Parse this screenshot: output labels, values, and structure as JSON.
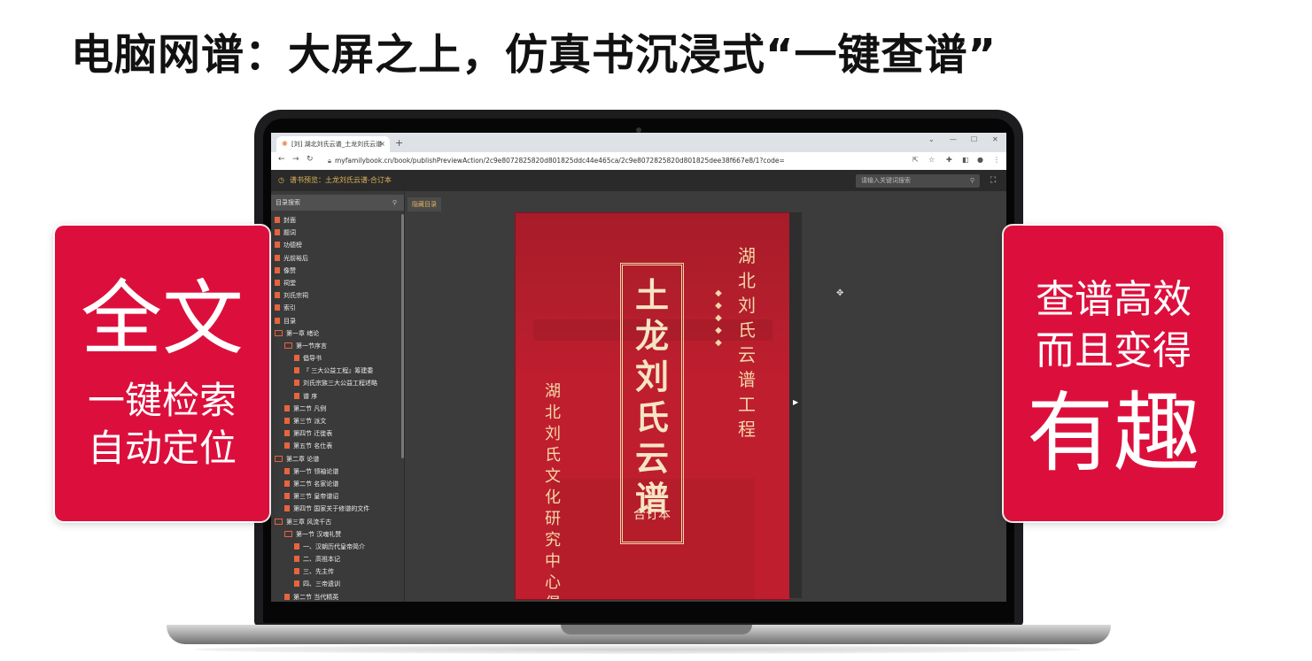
{
  "headline": "电脑网谱：大屏之上，仿真书沉浸式“一键查谱”",
  "browser": {
    "tab_title": "[刘] 湖北刘氏云谱_土龙刘氏云谱",
    "tab_close": "×",
    "new_tab": "+",
    "url": "myfamilybook.cn/book/publishPreviewAction/2c9e8072825820d801825ddc44e465ca/2c9e8072825820d801825dee38f667e8/1?code="
  },
  "app": {
    "title": "谱书预览：土龙刘氏云谱-合订本",
    "search_placeholder": "请输入关键词搜索",
    "sidebar_search_placeholder": "目录搜索",
    "hide_toc_label": "隐藏目录"
  },
  "toc": [
    {
      "label": "封面",
      "level": 0,
      "type": "page"
    },
    {
      "label": "题词",
      "level": 0,
      "type": "page"
    },
    {
      "label": "功德榜",
      "level": 0,
      "type": "page"
    },
    {
      "label": "光前裕后",
      "level": 0,
      "type": "page"
    },
    {
      "label": "像赞",
      "level": 0,
      "type": "page"
    },
    {
      "label": "祠堂",
      "level": 0,
      "type": "page"
    },
    {
      "label": "刘氏宗祠",
      "level": 0,
      "type": "page"
    },
    {
      "label": "索引",
      "level": 0,
      "type": "page"
    },
    {
      "label": "目录",
      "level": 0,
      "type": "page"
    },
    {
      "label": "第一章 绪论",
      "level": 0,
      "type": "folder"
    },
    {
      "label": "第一节序言",
      "level": 1,
      "type": "folder"
    },
    {
      "label": "倡导书",
      "level": 2,
      "type": "page"
    },
    {
      "label": "『 三大公益工程』筹建委",
      "level": 2,
      "type": "page"
    },
    {
      "label": "刘氏宗族三大公益工程述略",
      "level": 2,
      "type": "page"
    },
    {
      "label": "谱 序",
      "level": 2,
      "type": "page"
    },
    {
      "label": "第二节 凡例",
      "level": 1,
      "type": "page"
    },
    {
      "label": "第三节 派文",
      "level": 1,
      "type": "page"
    },
    {
      "label": "第四节 迁徙表",
      "level": 1,
      "type": "page"
    },
    {
      "label": "第五节 名仕表",
      "level": 1,
      "type": "page"
    },
    {
      "label": "第二章 论谱",
      "level": 0,
      "type": "folder"
    },
    {
      "label": "第一节 领袖论谱",
      "level": 1,
      "type": "page"
    },
    {
      "label": "第二节 名家论谱",
      "level": 1,
      "type": "page"
    },
    {
      "label": "第三节 皇帝谱诏",
      "level": 1,
      "type": "page"
    },
    {
      "label": "第四节 国家关于修谱的文件",
      "level": 1,
      "type": "page"
    },
    {
      "label": "第三章 风流千古",
      "level": 0,
      "type": "folder"
    },
    {
      "label": "第一节 汉魂礼赞",
      "level": 1,
      "type": "folder"
    },
    {
      "label": "一、汉朝历代皇帝简介",
      "level": 2,
      "type": "page"
    },
    {
      "label": "二、高祖本记",
      "level": 2,
      "type": "page"
    },
    {
      "label": "三、先主传",
      "level": 2,
      "type": "page"
    },
    {
      "label": "四、三帝遗训",
      "level": 2,
      "type": "page"
    },
    {
      "label": "第二节 当代精英",
      "level": 1,
      "type": "page"
    }
  ],
  "book": {
    "title": "土龙刘氏云谱",
    "subtitle": "合订本",
    "left_column": "湖北刘氏文化研究中心倡修",
    "right_column": "湖北刘氏云谱工程"
  },
  "callout_left": {
    "big": "全文",
    "line1": "一键检索",
    "line2": "自动定位"
  },
  "callout_right": {
    "line1": "查谱高效",
    "line2": "而且变得",
    "big": "有趣"
  },
  "colors": {
    "accent_red": "#dc0f3c",
    "book_red": "#bf1e2e",
    "gold_text": "#e0b25a",
    "toc_icon": "#e8643c"
  }
}
